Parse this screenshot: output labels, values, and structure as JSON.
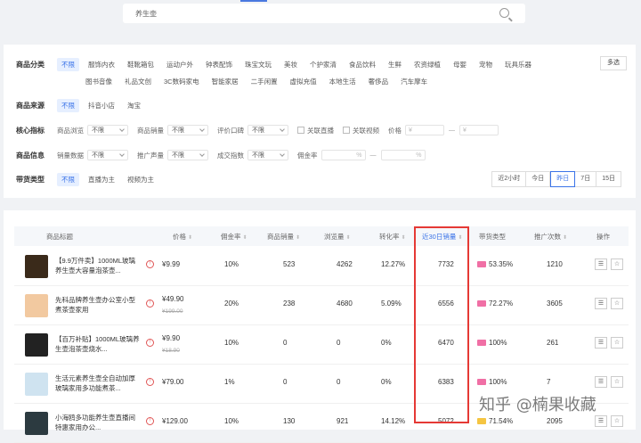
{
  "search": {
    "query": "养生壶"
  },
  "filters": {
    "category": {
      "label": "商品分类",
      "options_row1": [
        "不限",
        "服饰内衣",
        "鞋靴箱包",
        "运动户外",
        "钟表配饰",
        "珠宝文玩",
        "美妆",
        "个护家清",
        "食品饮料",
        "生鲜",
        "农资绿植",
        "母婴",
        "宠物",
        "玩具乐器"
      ],
      "options_row2": [
        "图书音像",
        "礼品文创",
        "3C数码家电",
        "智能家居",
        "二手闲置",
        "虚拟充值",
        "本地生活",
        "奢侈品",
        "汽车摩车"
      ],
      "multi_label": "多选"
    },
    "source": {
      "label": "商品来源",
      "options": [
        "不限",
        "抖音小店",
        "淘宝"
      ]
    },
    "metrics": {
      "label": "核心指标",
      "items": [
        {
          "name": "商品浏览",
          "value": "不限"
        },
        {
          "name": "商品销量",
          "value": "不限"
        },
        {
          "name": "评价口碑",
          "value": "不限"
        }
      ],
      "checkbox1": "关联直播",
      "checkbox2": "关联视频",
      "price_label": "价格",
      "price_min": "¥",
      "price_max": "¥",
      "dash": "—"
    },
    "info": {
      "label": "商品信息",
      "items": [
        {
          "name": "销量数据",
          "value": "不限"
        },
        {
          "name": "推广声量",
          "value": "不限"
        },
        {
          "name": "成交指数",
          "value": "不限"
        }
      ],
      "commission_label": "佣金率",
      "pct_min": "%",
      "pct_max": "%",
      "dash": "—"
    },
    "live_type": {
      "label": "带货类型",
      "options": [
        "不限",
        "直播为主",
        "视频为主"
      ]
    },
    "time_range": [
      "近2小时",
      "今日",
      "昨日",
      "7日",
      "15日"
    ]
  },
  "table": {
    "headers": [
      "商品标题",
      "价格",
      "佣金率",
      "商品销量",
      "浏览量",
      "转化率",
      "近30日销量",
      "带货类型",
      "推广次数",
      "操作"
    ],
    "rows": [
      {
        "title": "【9.9万件卖】1000ML玻璃养生壶大容量泡茶壶...",
        "price": "¥9.99",
        "orig": "",
        "commission": "10%",
        "sales": "523",
        "views": "4262",
        "conversion": "12.27%",
        "sales30": "7732",
        "type_pct": "53.35%",
        "promo": "1210",
        "thumb_color": "#3a2a1a",
        "bar_color": "#f06fa5"
      },
      {
        "title": "先科品牌养生壶办公室小型煮茶壶家用",
        "price": "¥49.90",
        "orig": "¥199.00",
        "commission": "20%",
        "sales": "238",
        "views": "4680",
        "conversion": "5.09%",
        "sales30": "6556",
        "type_pct": "72.27%",
        "promo": "3605",
        "thumb_color": "#f2c9a0",
        "bar_color": "#f06fa5"
      },
      {
        "title": "【百万补贴】1000ML玻璃养生壶泡茶壶烧水...",
        "price": "¥9.90",
        "orig": "¥18.90",
        "commission": "10%",
        "sales": "0",
        "views": "0",
        "conversion": "0%",
        "sales30": "6470",
        "type_pct": "100%",
        "promo": "261",
        "thumb_color": "#222222",
        "bar_color": "#f06fa5"
      },
      {
        "title": "生活元素养生壶全自动加厚玻璃家用多功能煮茶...",
        "price": "¥79.00",
        "orig": "",
        "commission": "1%",
        "sales": "0",
        "views": "0",
        "conversion": "0%",
        "sales30": "6383",
        "type_pct": "100%",
        "promo": "7",
        "thumb_color": "#cfe3f0",
        "bar_color": "#f06fa5"
      },
      {
        "title": "小海鸥多功能养生壶直播间特惠家用办公...",
        "price": "¥129.00",
        "orig": "",
        "commission": "10%",
        "sales": "130",
        "views": "921",
        "conversion": "14.12%",
        "sales30": "5072",
        "type_pct": "71.54%",
        "promo": "2095",
        "thumb_color": "#2c3a40",
        "bar_color": "#f5c542"
      }
    ],
    "op_icons": [
      "list-icon",
      "star-icon"
    ]
  },
  "watermark": "知乎 @楠果收藏"
}
